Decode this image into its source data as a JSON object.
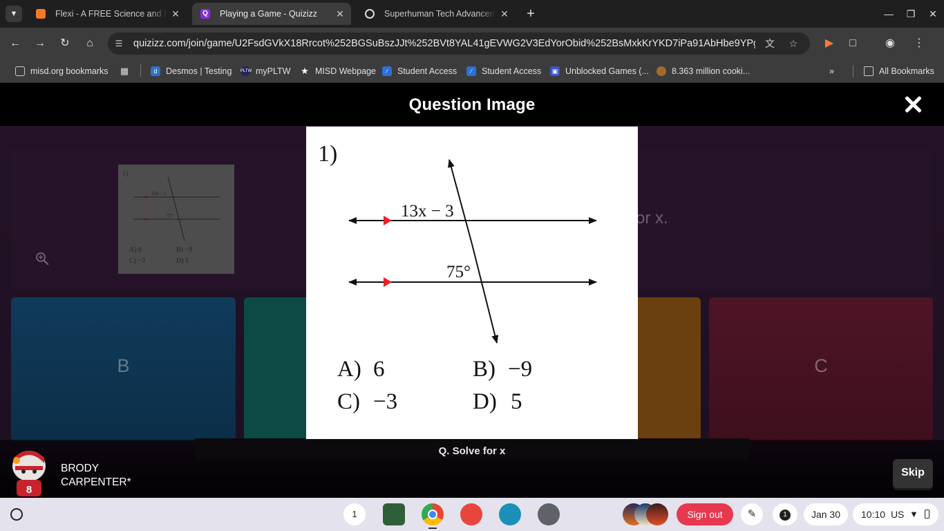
{
  "browser": {
    "tabs": [
      {
        "title": "Flexi - A FREE Science and Math",
        "favicon": "flexi-icon",
        "active": false
      },
      {
        "title": "Playing a Game - Quizizz",
        "favicon": "quizizz-icon",
        "active": true
      },
      {
        "title": "Superhuman Tech Advancement",
        "favicon": "openai-icon",
        "active": false
      }
    ],
    "url": "quizizz.com/join/game/U2FsdGVkX18Rrcot%252BGSuBszJJt%252BVt8YAL41gEVWG2V3EdYorObid%252BsMxkKrYKD7iPa91AbHbe9YPg3%2...",
    "bookmarks": [
      {
        "label": "misd.org bookmarks",
        "icon": "managed-folder-icon"
      },
      {
        "label": "",
        "icon": "apps-grid-icon"
      },
      {
        "label": "Desmos | Testing",
        "icon": "desmos-icon"
      },
      {
        "label": "myPLTW",
        "icon": "pltw-icon"
      },
      {
        "label": "MISD Webpage",
        "icon": "star-icon"
      },
      {
        "label": "Student Access",
        "icon": "student-access-icon"
      },
      {
        "label": "Student Access",
        "icon": "student-access-icon"
      },
      {
        "label": "Unblocked Games (...",
        "icon": "games-icon"
      },
      {
        "label": "8.363 million cooki...",
        "icon": "cookie-icon"
      }
    ],
    "all_bookmarks": "All Bookmarks"
  },
  "quiz": {
    "modal_title": "Question Image",
    "background_question_text": "or x.",
    "question_strip": "Q. Solve for x",
    "options": {
      "b": "B",
      "c": "C"
    },
    "player": {
      "first": "BRODY",
      "last": "CARPENTER*"
    },
    "skip_label": "Skip",
    "avatar_number": "8"
  },
  "figure": {
    "number": "1)",
    "angle_top": "13x − 3",
    "angle_bottom": "75°",
    "answers": [
      {
        "letter": "A)",
        "value": "6"
      },
      {
        "letter": "B)",
        "value": "−9"
      },
      {
        "letter": "C)",
        "value": "−3"
      },
      {
        "letter": "D)",
        "value": "5"
      }
    ]
  },
  "shelf": {
    "desk_count": "1",
    "sign_out": "Sign out",
    "notification_count": "1",
    "date": "Jan 30",
    "time": "10:10",
    "locale": "US"
  },
  "colors": {
    "parallel_marker": "#e8202a",
    "sign_out_bg": "#e63950",
    "quizizz_brand": "#8a2be2"
  }
}
